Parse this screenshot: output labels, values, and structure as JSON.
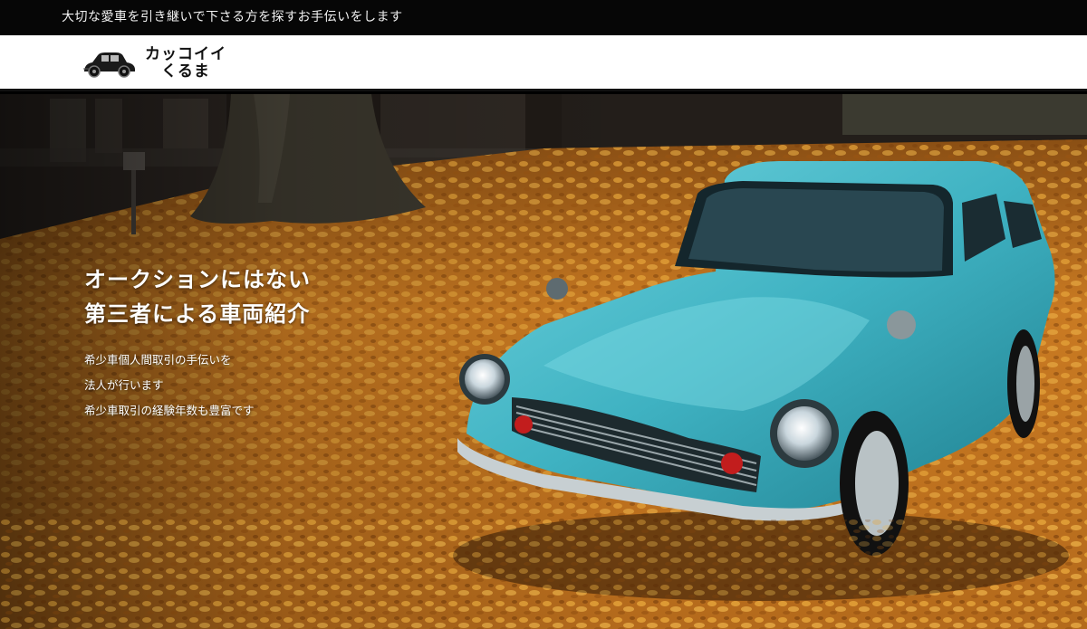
{
  "topbar": {
    "tagline": "大切な愛車を引き継いで下さる方を探すお手伝いをします"
  },
  "header": {
    "logo": {
      "line1": "カッコイイ",
      "line2": "くるま",
      "icon": "classic-car-icon"
    }
  },
  "hero": {
    "headline_line1": "オークションにはない",
    "headline_line2": "第三者による車両紹介",
    "body_lines": [
      "希少車個人間取引の手伝いを",
      "法人が行います",
      "希少車取引の経験年数も豊富です"
    ],
    "image_subject": "turquoise classic car on autumn leaves",
    "colors": {
      "car": "#3fb8c8",
      "leaves": "#d98a24",
      "topbar": "#060606"
    }
  }
}
